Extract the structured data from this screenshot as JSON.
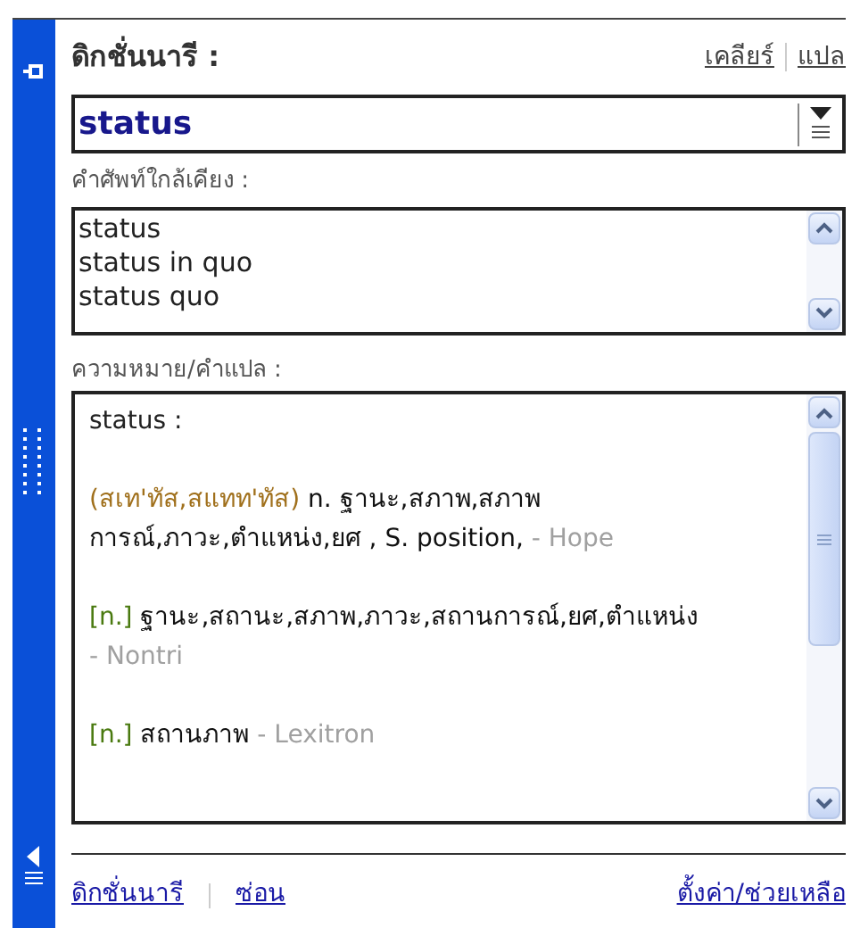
{
  "header": {
    "title": "ดิกชั่นนารี :",
    "links": [
      "เคลียร์",
      "แปล"
    ]
  },
  "search": {
    "value": "status"
  },
  "similar": {
    "label": "คำศัพท์ใกล้เคียง :",
    "items": [
      "status",
      "status in quo",
      "status quo"
    ]
  },
  "meaning": {
    "label": "ความหมาย/คำแปล :",
    "headword": "status :",
    "entries": [
      {
        "prefix": "(สเท'ทัส,สแทท'ทัส)",
        "color": "#a0701c",
        "text": "n. ฐานะ,สภาพ,สภาพการณ์,ภาวะ,ตำแหน่ง,ยศ , S. position,",
        "source": "- Hope"
      },
      {
        "prefix": "[n.]",
        "color": "#4a7a10",
        "text": "ฐานะ,สถานะ,สภาพ,ภาวะ,สถานการณ์,ยศ,ตำแหน่ง",
        "source": "- Nontri"
      },
      {
        "prefix": "[n.]",
        "color": "#4a7a10",
        "text": "สถานภาพ",
        "source": "- Lexitron"
      }
    ]
  },
  "footer": {
    "links": [
      "ดิกชั่นนารี",
      "ซ่อน"
    ],
    "right_link": "ตั้งค่า/ช่วยเหลือ"
  }
}
